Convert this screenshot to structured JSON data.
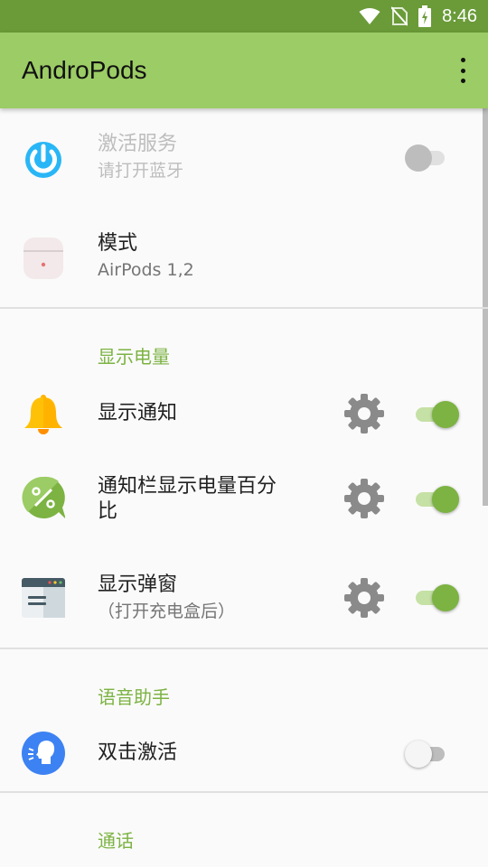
{
  "status_bar": {
    "time": "8:46",
    "icons": [
      "wifi-icon",
      "no-sim-icon",
      "battery-charging-icon"
    ]
  },
  "app_bar": {
    "title": "AndroPods",
    "menu_icon": "more-vert-icon"
  },
  "settings": {
    "activate_service": {
      "title": "激活服务",
      "summary": "请打开蓝牙",
      "enabled": false,
      "checked": false,
      "icon": "power-icon"
    },
    "mode": {
      "title": "模式",
      "summary": "AirPods 1,2",
      "icon": "airpods-case-icon"
    },
    "battery_category": "显示电量",
    "show_notification": {
      "title": "显示通知",
      "checked": true,
      "icon": "bell-icon"
    },
    "statusbar_percent": {
      "title_line1": "通知栏显示电量百分",
      "title_line2": "比",
      "checked": true,
      "icon": "percent-icon"
    },
    "popup": {
      "title": "显示弹窗",
      "summary": "（打开充电盒后）",
      "checked": true,
      "icon": "window-icon"
    },
    "voice_category": "语音助手",
    "double_tap": {
      "title": "双击激活",
      "checked": false,
      "icon": "voice-head-icon"
    },
    "call_category": "通话"
  },
  "colors": {
    "accent": "#7cb342",
    "appbar": "#9ccc65",
    "statusbar": "#6a9b38"
  }
}
